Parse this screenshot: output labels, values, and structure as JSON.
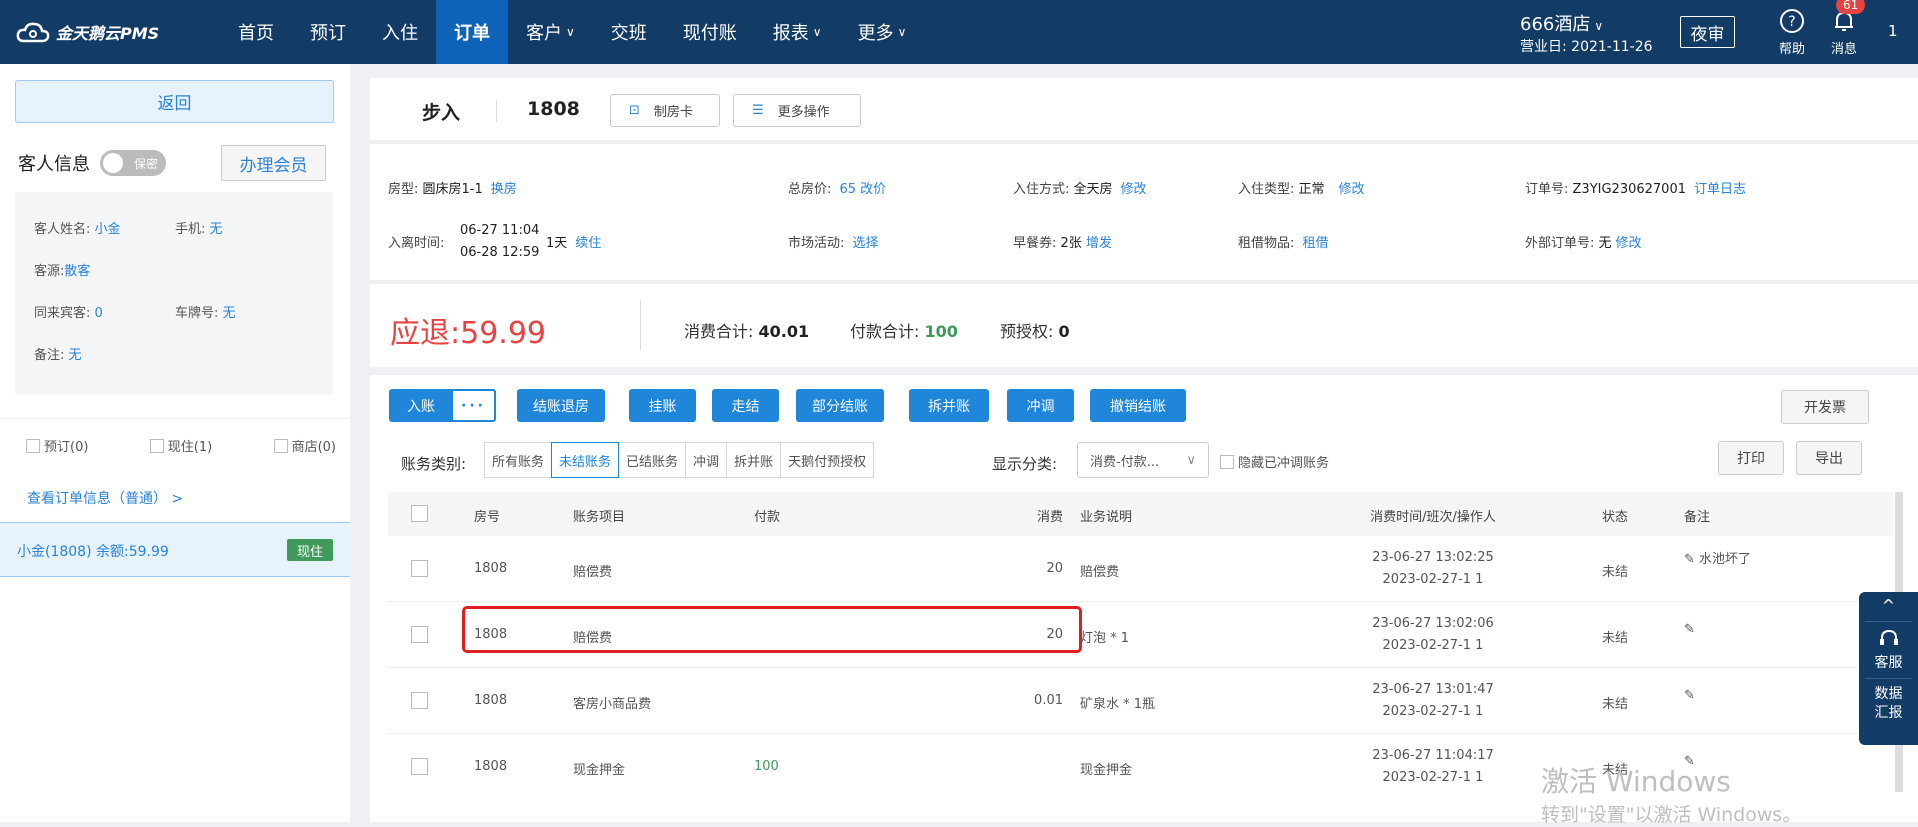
{
  "header": {
    "logo": "金天鹅云PMS",
    "nav": [
      {
        "label": "首页"
      },
      {
        "label": "预订"
      },
      {
        "label": "入住"
      },
      {
        "label": "订单",
        "active": true
      },
      {
        "label": "客户",
        "dropdown": true
      },
      {
        "label": "交班"
      },
      {
        "label": "现付账"
      },
      {
        "label": "报表",
        "dropdown": true
      },
      {
        "label": "更多",
        "dropdown": true
      }
    ],
    "hotel": "666酒店",
    "business_day": "营业日: 2021-11-26",
    "night_audit": "夜审",
    "help": "帮助",
    "messages": "消息",
    "message_count": "61",
    "user": "1"
  },
  "left": {
    "back": "返回",
    "guest_info_title": "客人信息",
    "privacy_toggle": "保密",
    "member_button": "办理会员",
    "fields": {
      "name_label": "客人姓名:",
      "name": "小金",
      "phone_label": "手机:",
      "phone": "无",
      "source_label": "客源:",
      "source": "散客",
      "companions_label": "同来宾客:",
      "companions": "0",
      "plate_label": "车牌号:",
      "plate": "无",
      "remark_label": "备注:",
      "remark": "无"
    },
    "tabs": [
      "预订(0)",
      "现住(1)",
      "商店(0)"
    ],
    "order_link": "查看订单信息（普通） >",
    "selected_room": "小金(1808)  余额:59.99",
    "selected_tag": "现住"
  },
  "order": {
    "type": "步入",
    "room": "1808",
    "make_card": "制房卡",
    "more_ops": "更多操作",
    "room_type_label": "房型:",
    "room_type": "圆床房1-1",
    "change_room": "换房",
    "total_price_label": "总房价:",
    "total_price": "65",
    "change_price": "改价",
    "checkin_mode_label": "入住方式:",
    "checkin_mode": "全天房",
    "modify": "修改",
    "checkin_type_label": "入住类型:",
    "checkin_type": "正常",
    "order_no_label": "订单号:",
    "order_no": "Z3YIG230627001",
    "order_log": "订单日志",
    "inout_label": "入离时间:",
    "in_time": "06-27 11:04",
    "out_time": "06-28 12:59",
    "nights": "1天",
    "extend": "续住",
    "market_label": "市场活动:",
    "market": "选择",
    "breakfast_label": "早餐券:",
    "breakfast": "2张",
    "add": "增发",
    "rental_label": "租借物品:",
    "rental": "租借",
    "ext_order_label": "外部订单号:",
    "ext_order": "无"
  },
  "summary": {
    "refund_label": "应退:",
    "refund": "59.99",
    "consume_label": "消费合计:",
    "consume": "40.01",
    "payment_label": "付款合计:",
    "payment": "100",
    "preauth_label": "预授权:",
    "preauth": "0"
  },
  "actions": {
    "buttons": [
      "入账",
      "结账退房",
      "挂账",
      "走结",
      "部分结账",
      "拆并账",
      "冲调",
      "撤销结账"
    ],
    "more": "···",
    "invoice": "开发票",
    "print": "打印",
    "export": "导出"
  },
  "filters": {
    "category_label": "账务类别:",
    "categories": [
      "所有账务",
      "未结账务",
      "已结账务",
      "冲调",
      "拆并账",
      "天鹅付预授权"
    ],
    "active_category": 1,
    "display_label": "显示分类:",
    "display_value": "消费-付款...",
    "hide_label": "隐藏已冲调账务"
  },
  "table": {
    "headers": [
      "房号",
      "账务项目",
      "付款",
      "消费",
      "业务说明",
      "消费时间/班次/操作人",
      "状态",
      "备注"
    ],
    "rows": [
      {
        "room": "1808",
        "item": "赔偿费",
        "payment": "",
        "consume": "20",
        "desc": "赔偿费",
        "time": "23-06-27 13:02:25",
        "shift": "2023-02-27-1 1",
        "status": "未结",
        "remark": "水池坏了"
      },
      {
        "room": "1808",
        "item": "赔偿费",
        "payment": "",
        "consume": "20",
        "desc": "灯泡 * 1",
        "time": "23-06-27 13:02:06",
        "shift": "2023-02-27-1 1",
        "status": "未结",
        "remark": ""
      },
      {
        "room": "1808",
        "item": "客房小商品费",
        "payment": "",
        "consume": "0.01",
        "desc": "矿泉水 * 1瓶",
        "time": "23-06-27 13:01:47",
        "shift": "2023-02-27-1 1",
        "status": "未结",
        "remark": ""
      },
      {
        "room": "1808",
        "item": "现金押金",
        "payment": "100",
        "consume": "",
        "desc": "现金押金",
        "time": "23-06-27 11:04:17",
        "shift": "2023-02-27-1 1",
        "status": "未结",
        "remark": ""
      }
    ]
  },
  "side_widget": {
    "service": "客服",
    "data": "数据汇报"
  },
  "watermark": {
    "line1": "激活 Windows",
    "line2": "转到\"设置\"以激活 Windows。"
  }
}
